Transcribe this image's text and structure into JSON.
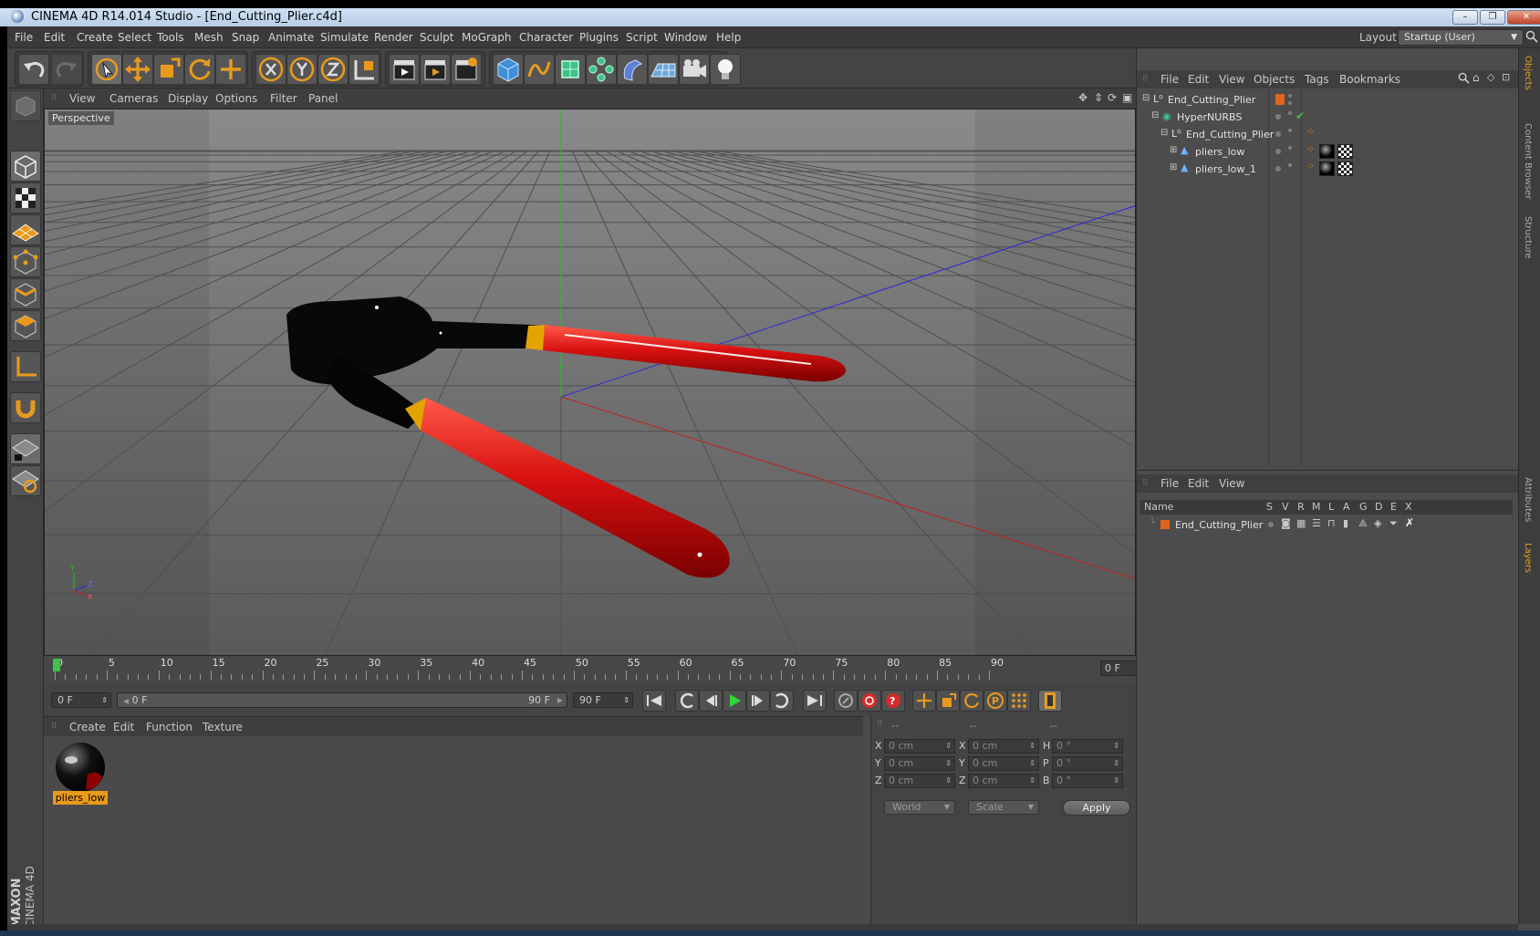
{
  "window": {
    "title": "CINEMA 4D R14.014 Studio - [End_Cutting_Plier.c4d]",
    "minimize": "–",
    "restore": "❐",
    "close": "✕"
  },
  "menubar": {
    "items": [
      "File",
      "Edit",
      "Create",
      "Select",
      "Tools",
      "Mesh",
      "Snap",
      "Animate",
      "Simulate",
      "Render",
      "Sculpt",
      "MoGraph",
      "Character",
      "Plugins",
      "Script",
      "Window",
      "Help"
    ],
    "layout_label": "Layout:",
    "layout_value": "Startup (User)"
  },
  "viewport": {
    "menu": [
      "View",
      "Cameras",
      "Display",
      "Options",
      "Filter",
      "Panel"
    ],
    "camera_label": "Perspective",
    "axis_y": "Y",
    "axis_z": "Z",
    "axis_x": "X"
  },
  "timeline": {
    "ticks": [
      "0",
      "5",
      "10",
      "15",
      "20",
      "25",
      "30",
      "35",
      "40",
      "45",
      "50",
      "55",
      "60",
      "65",
      "70",
      "75",
      "80",
      "85",
      "90"
    ],
    "current_frame": "0 F"
  },
  "transport": {
    "start_field": "0 F",
    "range_start": "0 F",
    "range_end": "90 F",
    "end_field": "90 F"
  },
  "material_manager": {
    "menu": [
      "Create",
      "Edit",
      "Function",
      "Texture"
    ],
    "materials": [
      {
        "name": "pliers_low"
      }
    ]
  },
  "coordinates": {
    "headers": [
      "--",
      "--",
      "--"
    ],
    "rows": [
      {
        "l1": "X",
        "v1": "0 cm",
        "l2": "X",
        "v2": "0 cm",
        "l3": "H",
        "v3": "0 °"
      },
      {
        "l1": "Y",
        "v1": "0 cm",
        "l2": "Y",
        "v2": "0 cm",
        "l3": "P",
        "v3": "0 °"
      },
      {
        "l1": "Z",
        "v1": "0 cm",
        "l2": "Z",
        "v2": "0 cm",
        "l3": "B",
        "v3": "0 °"
      }
    ],
    "space_select": "World",
    "mode_select": "Scale",
    "apply_label": "Apply"
  },
  "object_manager": {
    "menu": [
      "File",
      "Edit",
      "View",
      "Objects",
      "Tags",
      "Bookmarks"
    ],
    "objects": [
      {
        "name": "End_Cutting_Plier"
      },
      {
        "name": "HyperNURBS"
      },
      {
        "name": "End_Cutting_Plier"
      },
      {
        "name": "pliers_low"
      },
      {
        "name": "pliers_low_1"
      }
    ]
  },
  "layer_manager": {
    "menu": [
      "File",
      "Edit",
      "View"
    ],
    "columns": [
      "Name",
      "S",
      "V",
      "R",
      "M",
      "L",
      "A",
      "G",
      "D",
      "E",
      "X"
    ],
    "layers": [
      {
        "name": "End_Cutting_Plier"
      }
    ]
  },
  "side_tabs": [
    "Objects",
    "Content Browser",
    "Structure",
    "Attributes",
    "Layers"
  ],
  "logo": {
    "line1": "MAXON",
    "line2": "CINEMA 4D"
  },
  "colors": {
    "accent": "#e99a1c",
    "handle": "#cc1010",
    "band": "#e3a400"
  }
}
